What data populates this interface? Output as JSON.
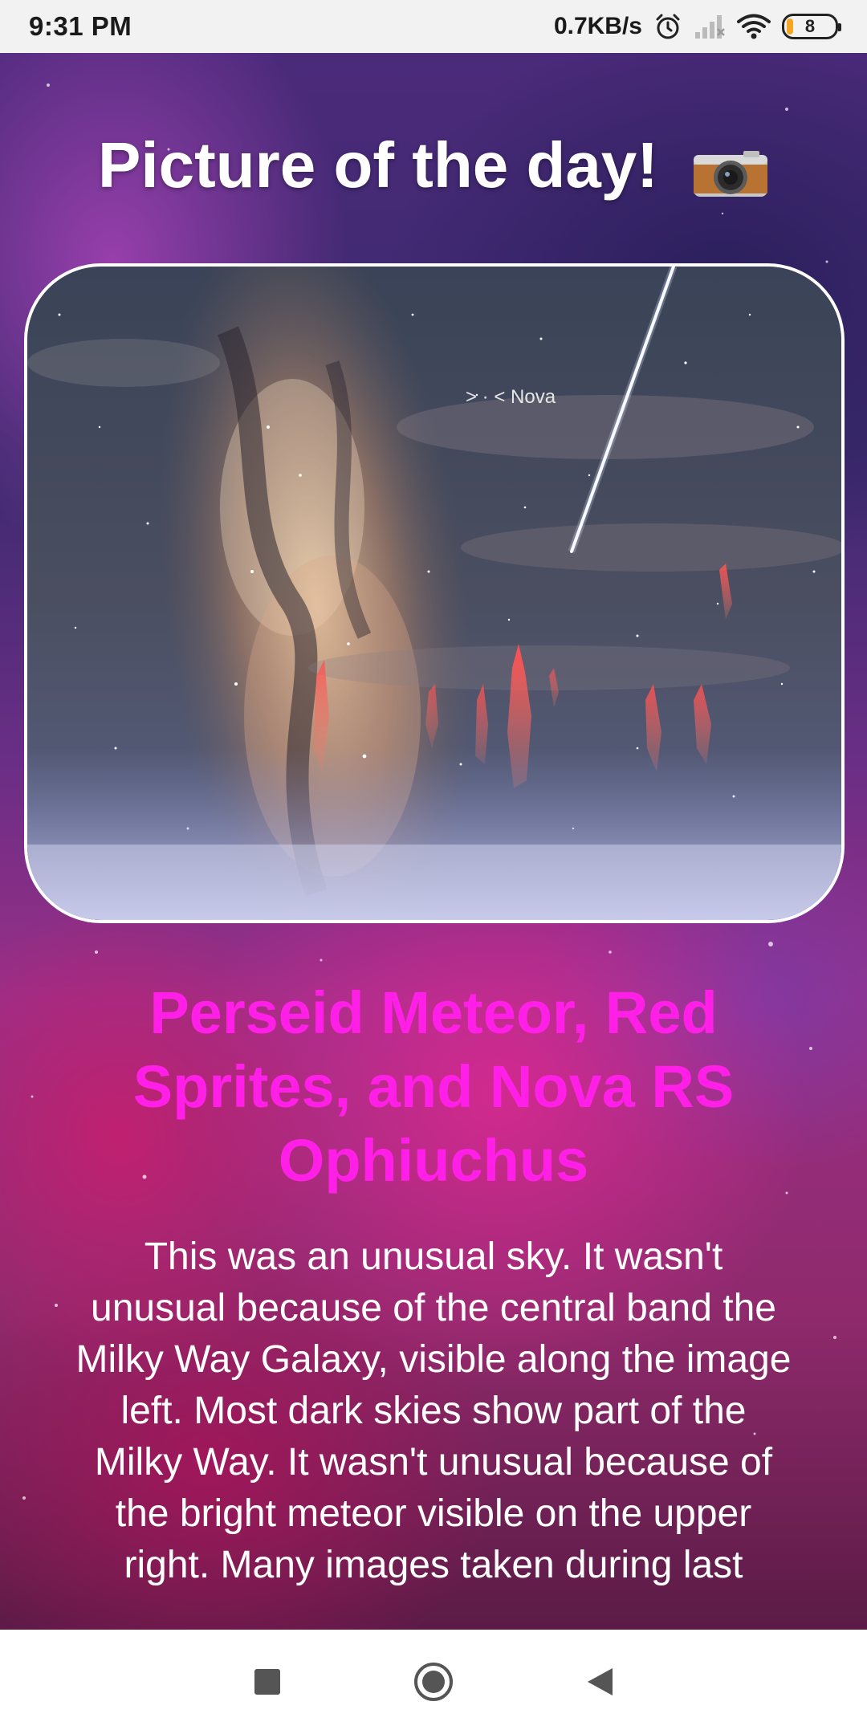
{
  "status_bar": {
    "time": "9:31 PM",
    "network_speed": "0.7KB/s",
    "battery_level": "8",
    "icons": [
      "alarm-icon",
      "signal-icon",
      "wifi-icon",
      "battery-icon"
    ]
  },
  "header": {
    "title": "Picture of the day!",
    "icon": "camera-icon"
  },
  "apod": {
    "image_annotation": "> · < Nova",
    "title": "Perseid Meteor, Red Sprites, and Nova RS Ophiuchus",
    "explanation": "This was an unusual sky. It wasn't unusual because of the central band the Milky Way Galaxy, visible along the image left.  Most dark skies show part of the Milky Way. It wasn't unusual because of the bright meteor visible on the upper right. Many images taken during last"
  },
  "nav_bar": {
    "buttons": [
      "recents-button",
      "home-button",
      "back-button"
    ]
  },
  "colors": {
    "title_accent": "#ff1fe6",
    "status_bar_bg": "#f2f2f2",
    "nav_bar_bg": "#ffffff"
  }
}
